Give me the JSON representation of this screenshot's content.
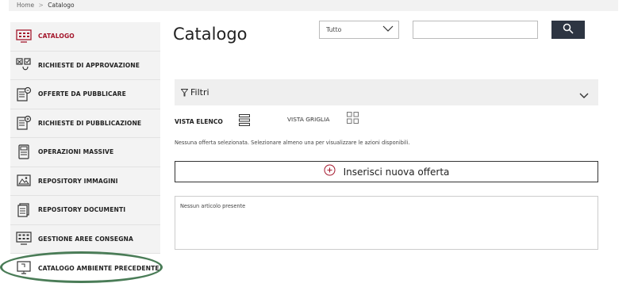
{
  "breadcrumb": {
    "home": "Home",
    "separator": ">",
    "current": "Catalogo"
  },
  "sidebar": {
    "items": [
      {
        "label": "CATALOGO",
        "icon": "catalog-grid-icon",
        "active": true
      },
      {
        "label": "RICHIESTE DI APPROVAZIONE",
        "icon": "approval-request-icon"
      },
      {
        "label": "OFFERTE DA PUBBLICARE",
        "icon": "offers-to-publish-icon"
      },
      {
        "label": "RICHIESTE DI PUBBLICAZIONE",
        "icon": "publication-request-icon"
      },
      {
        "label": "OPERAZIONI MASSIVE",
        "icon": "bulk-operations-icon"
      },
      {
        "label": "REPOSITORY IMMAGINI",
        "icon": "image-repository-icon"
      },
      {
        "label": "REPOSITORY DOCUMENTI",
        "icon": "document-repository-icon"
      },
      {
        "label": "GESTIONE AREE CONSEGNA",
        "icon": "delivery-areas-icon"
      },
      {
        "label": "CATALOGO AMBIENTE PRECEDENTE",
        "icon": "monitor-icon"
      }
    ]
  },
  "main": {
    "title": "Catalogo",
    "search": {
      "category_selected": "Tutto",
      "query": ""
    },
    "filters_label": "Filtri",
    "view_list_label": "VISTA ELENCO",
    "view_grid_label": "VISTA GRIGLIA",
    "selection_message": "Nessuna offerta selezionata. Selezionare almeno una per visualizzare le azioni disponibili.",
    "add_offer_label": "Inserisci nuova offerta",
    "empty_message": "Nessun articolo presente"
  },
  "colors": {
    "active": "#a4172c",
    "search_button": "#2d3542",
    "highlight_ellipse": "#4a7c57"
  }
}
